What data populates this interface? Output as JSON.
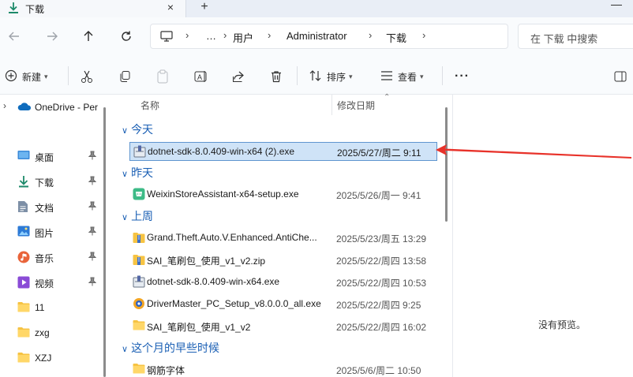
{
  "tab": {
    "title": "下载",
    "close_glyph": "×",
    "new_glyph": "+"
  },
  "address": {
    "items": [
      "…",
      "用户",
      "Administrator",
      "下载"
    ],
    "chevron": "›"
  },
  "search": {
    "placeholder": "在 下载 中搜索"
  },
  "toolbar": {
    "new_label": "新建",
    "sort_label": "排序",
    "view_label": "查看",
    "more_glyph": "···"
  },
  "sidebar": {
    "onedrive": "OneDrive - Per",
    "items": [
      {
        "label": "桌面",
        "icon": "desktop-icon",
        "pinned": true
      },
      {
        "label": "下载",
        "icon": "download-icon",
        "pinned": true
      },
      {
        "label": "文档",
        "icon": "document-icon",
        "pinned": true
      },
      {
        "label": "图片",
        "icon": "pictures-icon",
        "pinned": true
      },
      {
        "label": "音乐",
        "icon": "music-icon",
        "pinned": true
      },
      {
        "label": "视频",
        "icon": "video-icon",
        "pinned": true
      },
      {
        "label": "11",
        "icon": "folder-icon",
        "pinned": false
      },
      {
        "label": "zxg",
        "icon": "folder-icon",
        "pinned": false
      },
      {
        "label": "XZJ",
        "icon": "folder-icon",
        "pinned": false
      }
    ]
  },
  "columns": {
    "name": "名称",
    "modified": "修改日期"
  },
  "groups": [
    {
      "title": "今天"
    },
    {
      "title": "昨天"
    },
    {
      "title": "上周"
    },
    {
      "title": "这个月的早些时候"
    }
  ],
  "files": [
    {
      "name": "dotnet-sdk-8.0.409-win-x64 (2).exe",
      "date": "2025/5/27/周二 9:11",
      "icon": "installer-icon",
      "selected": true
    },
    {
      "name": "WeixinStoreAssistant-x64-setup.exe",
      "date": "2025/5/26/周一 9:41",
      "icon": "weixin-store-icon",
      "selected": false
    },
    {
      "name": "Grand.Theft.Auto.V.Enhanced.AntiChe...",
      "date": "2025/5/23/周五 13:29",
      "icon": "archive-icon",
      "selected": false
    },
    {
      "name": "SAI_笔刷包_使用_v1_v2.zip",
      "date": "2025/5/22/周四 13:58",
      "icon": "archive-icon",
      "selected": false
    },
    {
      "name": "dotnet-sdk-8.0.409-win-x64.exe",
      "date": "2025/5/22/周四 10:53",
      "icon": "installer-icon",
      "selected": false
    },
    {
      "name": "DriverMaster_PC_Setup_v8.0.0.0_all.exe",
      "date": "2025/5/22/周四 9:25",
      "icon": "driver-master-icon",
      "selected": false
    },
    {
      "name": "SAI_笔刷包_使用_v1_v2",
      "date": "2025/5/22/周四 16:02",
      "icon": "folder-icon",
      "selected": false
    },
    {
      "name": "钢筋字体",
      "date": "2025/5/6/周二 10:50",
      "icon": "folder-icon",
      "selected": false
    }
  ],
  "preview": {
    "empty_text": "没有预览。"
  },
  "colors": {
    "accent": "#1a5fb4",
    "selection": "#cfe3f7",
    "annotation": "#e8322a",
    "folder": "#f6c343"
  }
}
